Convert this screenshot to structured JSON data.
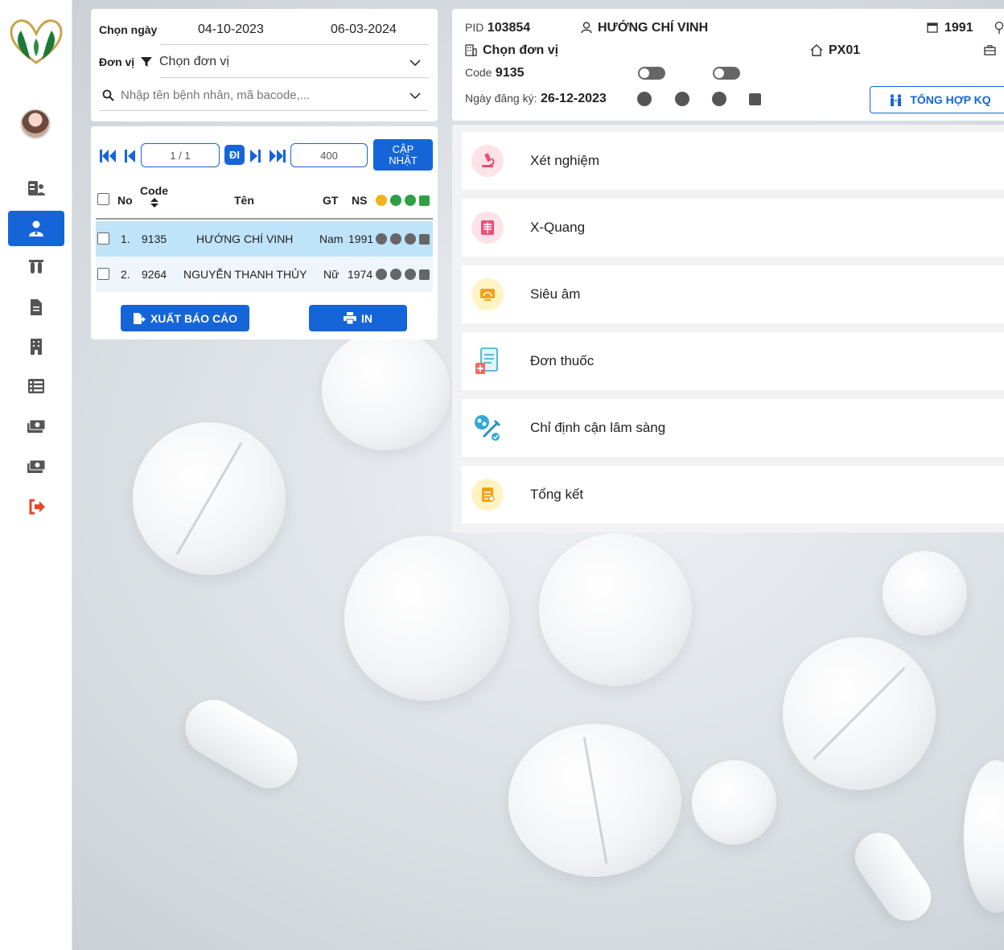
{
  "sidebar": {
    "logo_icon": "leaf-heart-logo",
    "items": [
      {
        "icon": "patient-card-icon",
        "active": false
      },
      {
        "icon": "doctor-icon",
        "active": true
      },
      {
        "icon": "test-tubes-icon",
        "active": false
      },
      {
        "icon": "document-icon",
        "active": false
      },
      {
        "icon": "building-icon",
        "active": false
      },
      {
        "icon": "list-icon",
        "active": false
      },
      {
        "icon": "money-icon",
        "active": false
      },
      {
        "icon": "money-icon",
        "active": false
      },
      {
        "icon": "logout-icon",
        "active": false
      }
    ],
    "active_color": "#1565d8",
    "logout_color": "#e8462a"
  },
  "filter": {
    "date_label": "Chọn ngày",
    "date_from": "04-10-2023",
    "date_to": "06-03-2024",
    "unit_label": "Đơn vị",
    "unit_value": "Chọn đơn vị",
    "search_placeholder": "Nhập tên bệnh nhân, mã bacode,..."
  },
  "pager": {
    "page": "1 / 1",
    "go_label": "ĐI",
    "page_size": "400",
    "update_label_1": "CẬP",
    "update_label_2": "NHẬT"
  },
  "table": {
    "headers": {
      "no": "No",
      "code": "Code",
      "name": "Tên",
      "gender": "GT",
      "birth": "NS"
    },
    "rows": [
      {
        "no": "1.",
        "code": "9135",
        "name": "HƯỚNG CHÍ VINH",
        "gender": "Nam",
        "birth": "1991",
        "selected": true
      },
      {
        "no": "2.",
        "code": "9264",
        "name": "NGUYỄN THANH THỦY",
        "gender": "Nữ",
        "birth": "1974",
        "selected": false
      }
    ]
  },
  "actions": {
    "export_label": "XUẤT BÁO CÁO",
    "print_label": "IN"
  },
  "patient": {
    "pid_label": "PID",
    "pid": "103854",
    "name": "HƯỚNG CHÍ VINH",
    "birth_year": "1991",
    "unit": "Chọn đơn vị",
    "room": "PX01",
    "code_label": "Code",
    "code": "9135",
    "reg_label": "Ngày đăng ký:",
    "reg_date": "26-12-2023",
    "summary_button": "TỔNG HỢP KQ"
  },
  "menu": {
    "items": [
      {
        "label": "Xét nghiệm",
        "icon": "microscope-icon",
        "color": "#fde3e8"
      },
      {
        "label": "X-Quang",
        "icon": "xray-icon",
        "color": "#fde3e8"
      },
      {
        "label": "Siêu âm",
        "icon": "ultrasound-icon",
        "color": "#fff3c4"
      },
      {
        "label": "Đơn thuốc",
        "icon": "prescription-icon",
        "color": "#ffffff"
      },
      {
        "label": "Chỉ định cận lâm sàng",
        "icon": "syringe-icon",
        "color": "#ffffff"
      },
      {
        "label": "Tổng kết",
        "icon": "summary-icon",
        "color": "#fff3c4"
      }
    ]
  }
}
